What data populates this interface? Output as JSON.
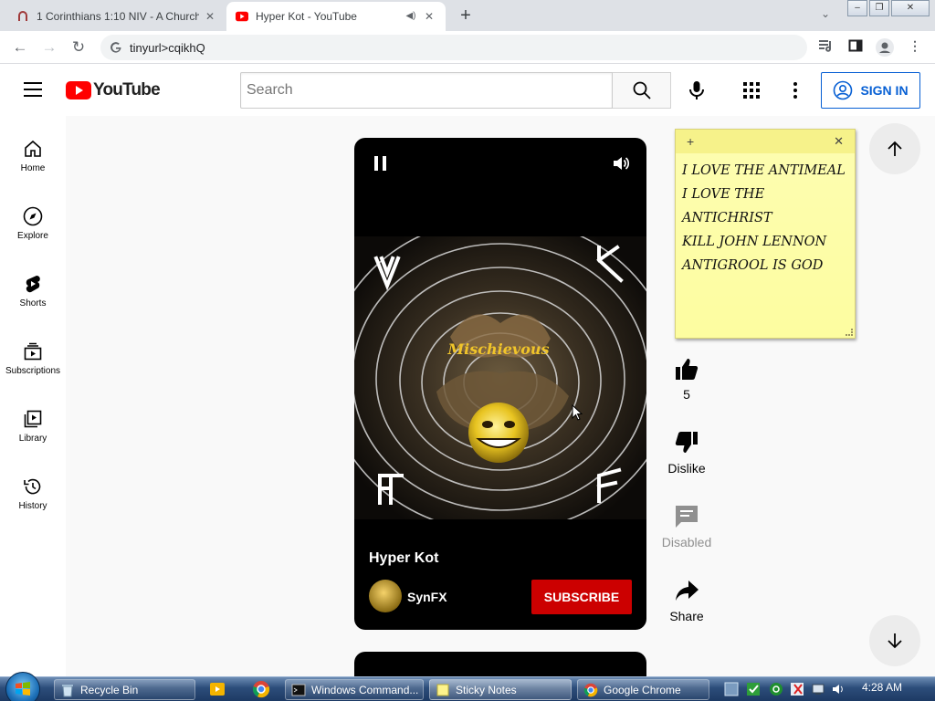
{
  "browser": {
    "tabs": [
      {
        "title": "1 Corinthians 1:10 NIV - A Church"
      },
      {
        "title": "Hyper Kot - YouTube"
      }
    ],
    "url": "tinyurl>cqikhQ"
  },
  "youtube": {
    "logo_text": "YouTube",
    "search_placeholder": "Search",
    "sign_in_label": "SIGN IN",
    "guide": [
      {
        "label": "Home",
        "icon": "home-icon"
      },
      {
        "label": "Explore",
        "icon": "compass-icon"
      },
      {
        "label": "Shorts",
        "icon": "shorts-icon"
      },
      {
        "label": "Subscriptions",
        "icon": "subscriptions-icon"
      },
      {
        "label": "Library",
        "icon": "library-icon"
      },
      {
        "label": "History",
        "icon": "history-icon"
      }
    ],
    "short": {
      "title": "Hyper Kot",
      "channel": "SynFX",
      "subscribe_label": "SUBSCRIBE",
      "overlay_text": "Mischievous"
    },
    "actions": {
      "like_count": "5",
      "dislike_label": "Dislike",
      "comments_label": "Disabled",
      "share_label": "Share"
    }
  },
  "sticky_note": {
    "lines": [
      "I LOVE THE ANTIMEAL",
      "I LOVE THE",
      "ANTICHRIST",
      "KILL JOHN LENNON",
      "ANTIGROOL IS GOD"
    ]
  },
  "taskbar": {
    "items": [
      "Recycle Bin",
      "Windows Command...",
      "Sticky Notes",
      "Google Chrome"
    ],
    "clock": "4:28 AM"
  },
  "colors": {
    "youtube_red": "#ff0000",
    "subscribe_red": "#cc0000",
    "sign_in_blue": "#065fd4",
    "sticky_yellow": "#fdfda0"
  }
}
